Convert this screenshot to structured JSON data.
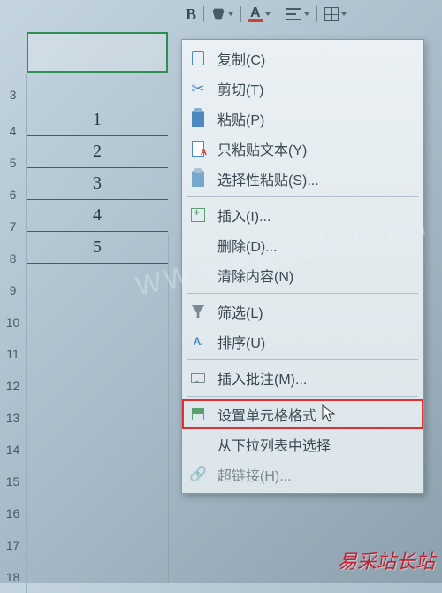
{
  "toolbar": {
    "bold_label": "B",
    "fontcolor_label": "A"
  },
  "rows": [
    "3",
    "4",
    "5",
    "6",
    "7",
    "8",
    "9",
    "10",
    "11",
    "12",
    "13",
    "14",
    "15",
    "16",
    "17",
    "18"
  ],
  "cells": [
    "1",
    "2",
    "3",
    "4",
    "5"
  ],
  "menu": {
    "copy": "复制(C)",
    "cut": "剪切(T)",
    "paste": "粘贴(P)",
    "paste_text": "只粘贴文本(Y)",
    "paste_special": "选择性粘贴(S)...",
    "insert": "插入(I)...",
    "delete": "删除(D)...",
    "clear": "清除内容(N)",
    "filter": "筛选(L)",
    "sort": "排序(U)",
    "insert_comment": "插入批注(M)...",
    "format_cells": "设置单元格格式",
    "from_dropdown": "从下拉列表中选择",
    "hyperlink": "超链接(H)..."
  },
  "watermark": {
    "diag": "www.easck.com",
    "br": "易采站长站"
  }
}
